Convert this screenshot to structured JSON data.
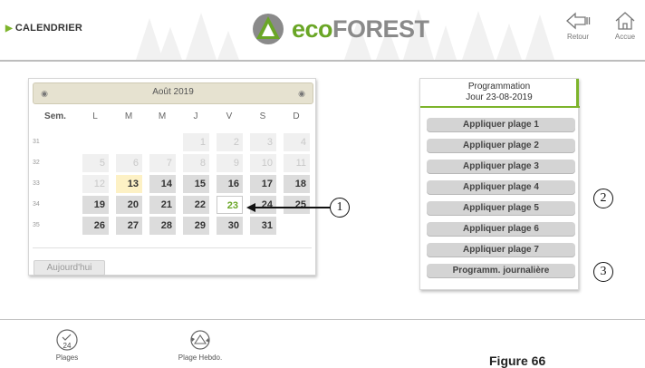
{
  "header": {
    "section_title": "CALENDRIER",
    "logo_prefix": "eco",
    "logo_suffix": "FOREST",
    "back_label": "Retour",
    "home_label": "Accue"
  },
  "calendar": {
    "month": "Août 2019",
    "prev_icon": "circle-dot-icon",
    "next_icon": "circle-dot-icon",
    "columns": [
      "Sem.",
      "L",
      "M",
      "M",
      "J",
      "V",
      "S",
      "D"
    ],
    "weeks": [
      {
        "num": "31",
        "days": [
          "",
          "",
          "",
          "1",
          "2",
          "3",
          "4"
        ]
      },
      {
        "num": "32",
        "days": [
          "5",
          "6",
          "7",
          "8",
          "9",
          "10",
          "11"
        ]
      },
      {
        "num": "33",
        "days": [
          "12",
          "13",
          "14",
          "15",
          "16",
          "17",
          "18"
        ]
      },
      {
        "num": "34",
        "days": [
          "19",
          "20",
          "21",
          "22",
          "23",
          "24",
          "25"
        ]
      },
      {
        "num": "35",
        "days": [
          "26",
          "27",
          "28",
          "29",
          "30",
          "31",
          ""
        ]
      }
    ],
    "today_label": "Aujourd'hui"
  },
  "program": {
    "title_line1": "Programmation",
    "title_line2": "Jour 23-08-2019",
    "buttons": [
      "Appliquer plage  1",
      "Appliquer plage  2",
      "Appliquer plage  3",
      "Appliquer plage  4",
      "Appliquer plage  5",
      "Appliquer plage  6",
      "Appliquer plage  7",
      "Programm. journalière"
    ]
  },
  "callouts": [
    "1",
    "2",
    "3"
  ],
  "footer": {
    "plages_label": "Plages",
    "plages_icon_text": "24",
    "hebdo_label": "Plage Hebdo."
  },
  "figure_caption": "Figure 66",
  "colors": {
    "accent_green": "#7db42b",
    "logo_green": "#6aa626"
  }
}
